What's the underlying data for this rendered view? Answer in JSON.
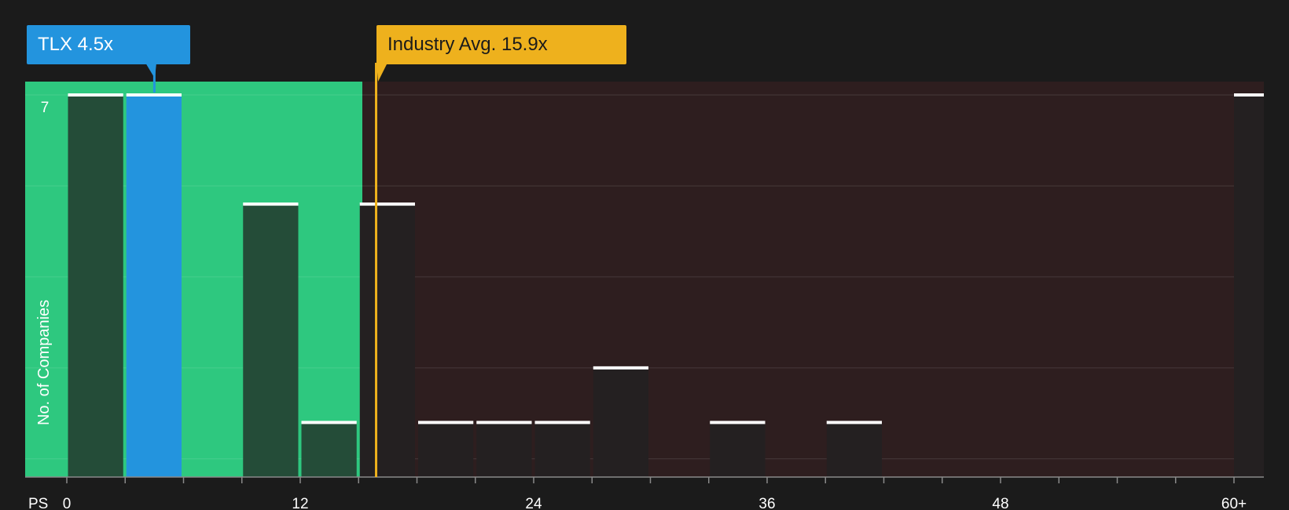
{
  "chart_data": {
    "type": "bar",
    "x_axis_label": "PS",
    "y_axis_label": "No. of Companies",
    "x_ticks": [
      "0",
      "12",
      "24",
      "36",
      "48",
      "60+"
    ],
    "y_tick_labels": [
      "7"
    ],
    "ylim": [
      0,
      7
    ],
    "bin_width": 3,
    "bins": [
      {
        "start": 0,
        "count": 7
      },
      {
        "start": 3,
        "count": 7,
        "highlight": true
      },
      {
        "start": 6,
        "count": 0
      },
      {
        "start": 9,
        "count": 5
      },
      {
        "start": 12,
        "count": 1
      },
      {
        "start": 15,
        "count": 5
      },
      {
        "start": 18,
        "count": 1
      },
      {
        "start": 21,
        "count": 1
      },
      {
        "start": 24,
        "count": 1
      },
      {
        "start": 27,
        "count": 2
      },
      {
        "start": 30,
        "count": 0
      },
      {
        "start": 33,
        "count": 1
      },
      {
        "start": 36,
        "count": 0
      },
      {
        "start": 39,
        "count": 1
      },
      {
        "start": 42,
        "count": 0
      },
      {
        "start": 45,
        "count": 0
      },
      {
        "start": 48,
        "count": 0
      },
      {
        "start": 51,
        "count": 0
      },
      {
        "start": 54,
        "count": 0
      },
      {
        "start": 57,
        "count": 0
      },
      {
        "start": 60,
        "count": 7,
        "overflow": true
      }
    ],
    "company": {
      "ticker": "TLX",
      "value": 4.5,
      "label": "TLX 4.5x"
    },
    "industry_avg": {
      "value": 15.9,
      "label": "Industry Avg. 15.9x"
    },
    "grid": true
  },
  "colors": {
    "background": "#1b1b1b",
    "fair_zone": "#2ec87f",
    "expensive_zone": "#2e1e1f",
    "company_bar": "#2394de",
    "industry_line": "#eeb11d",
    "bar_in_fair": "#244c38",
    "bar_in_expensive": "#242021",
    "bar_cap": "#ffffff"
  }
}
